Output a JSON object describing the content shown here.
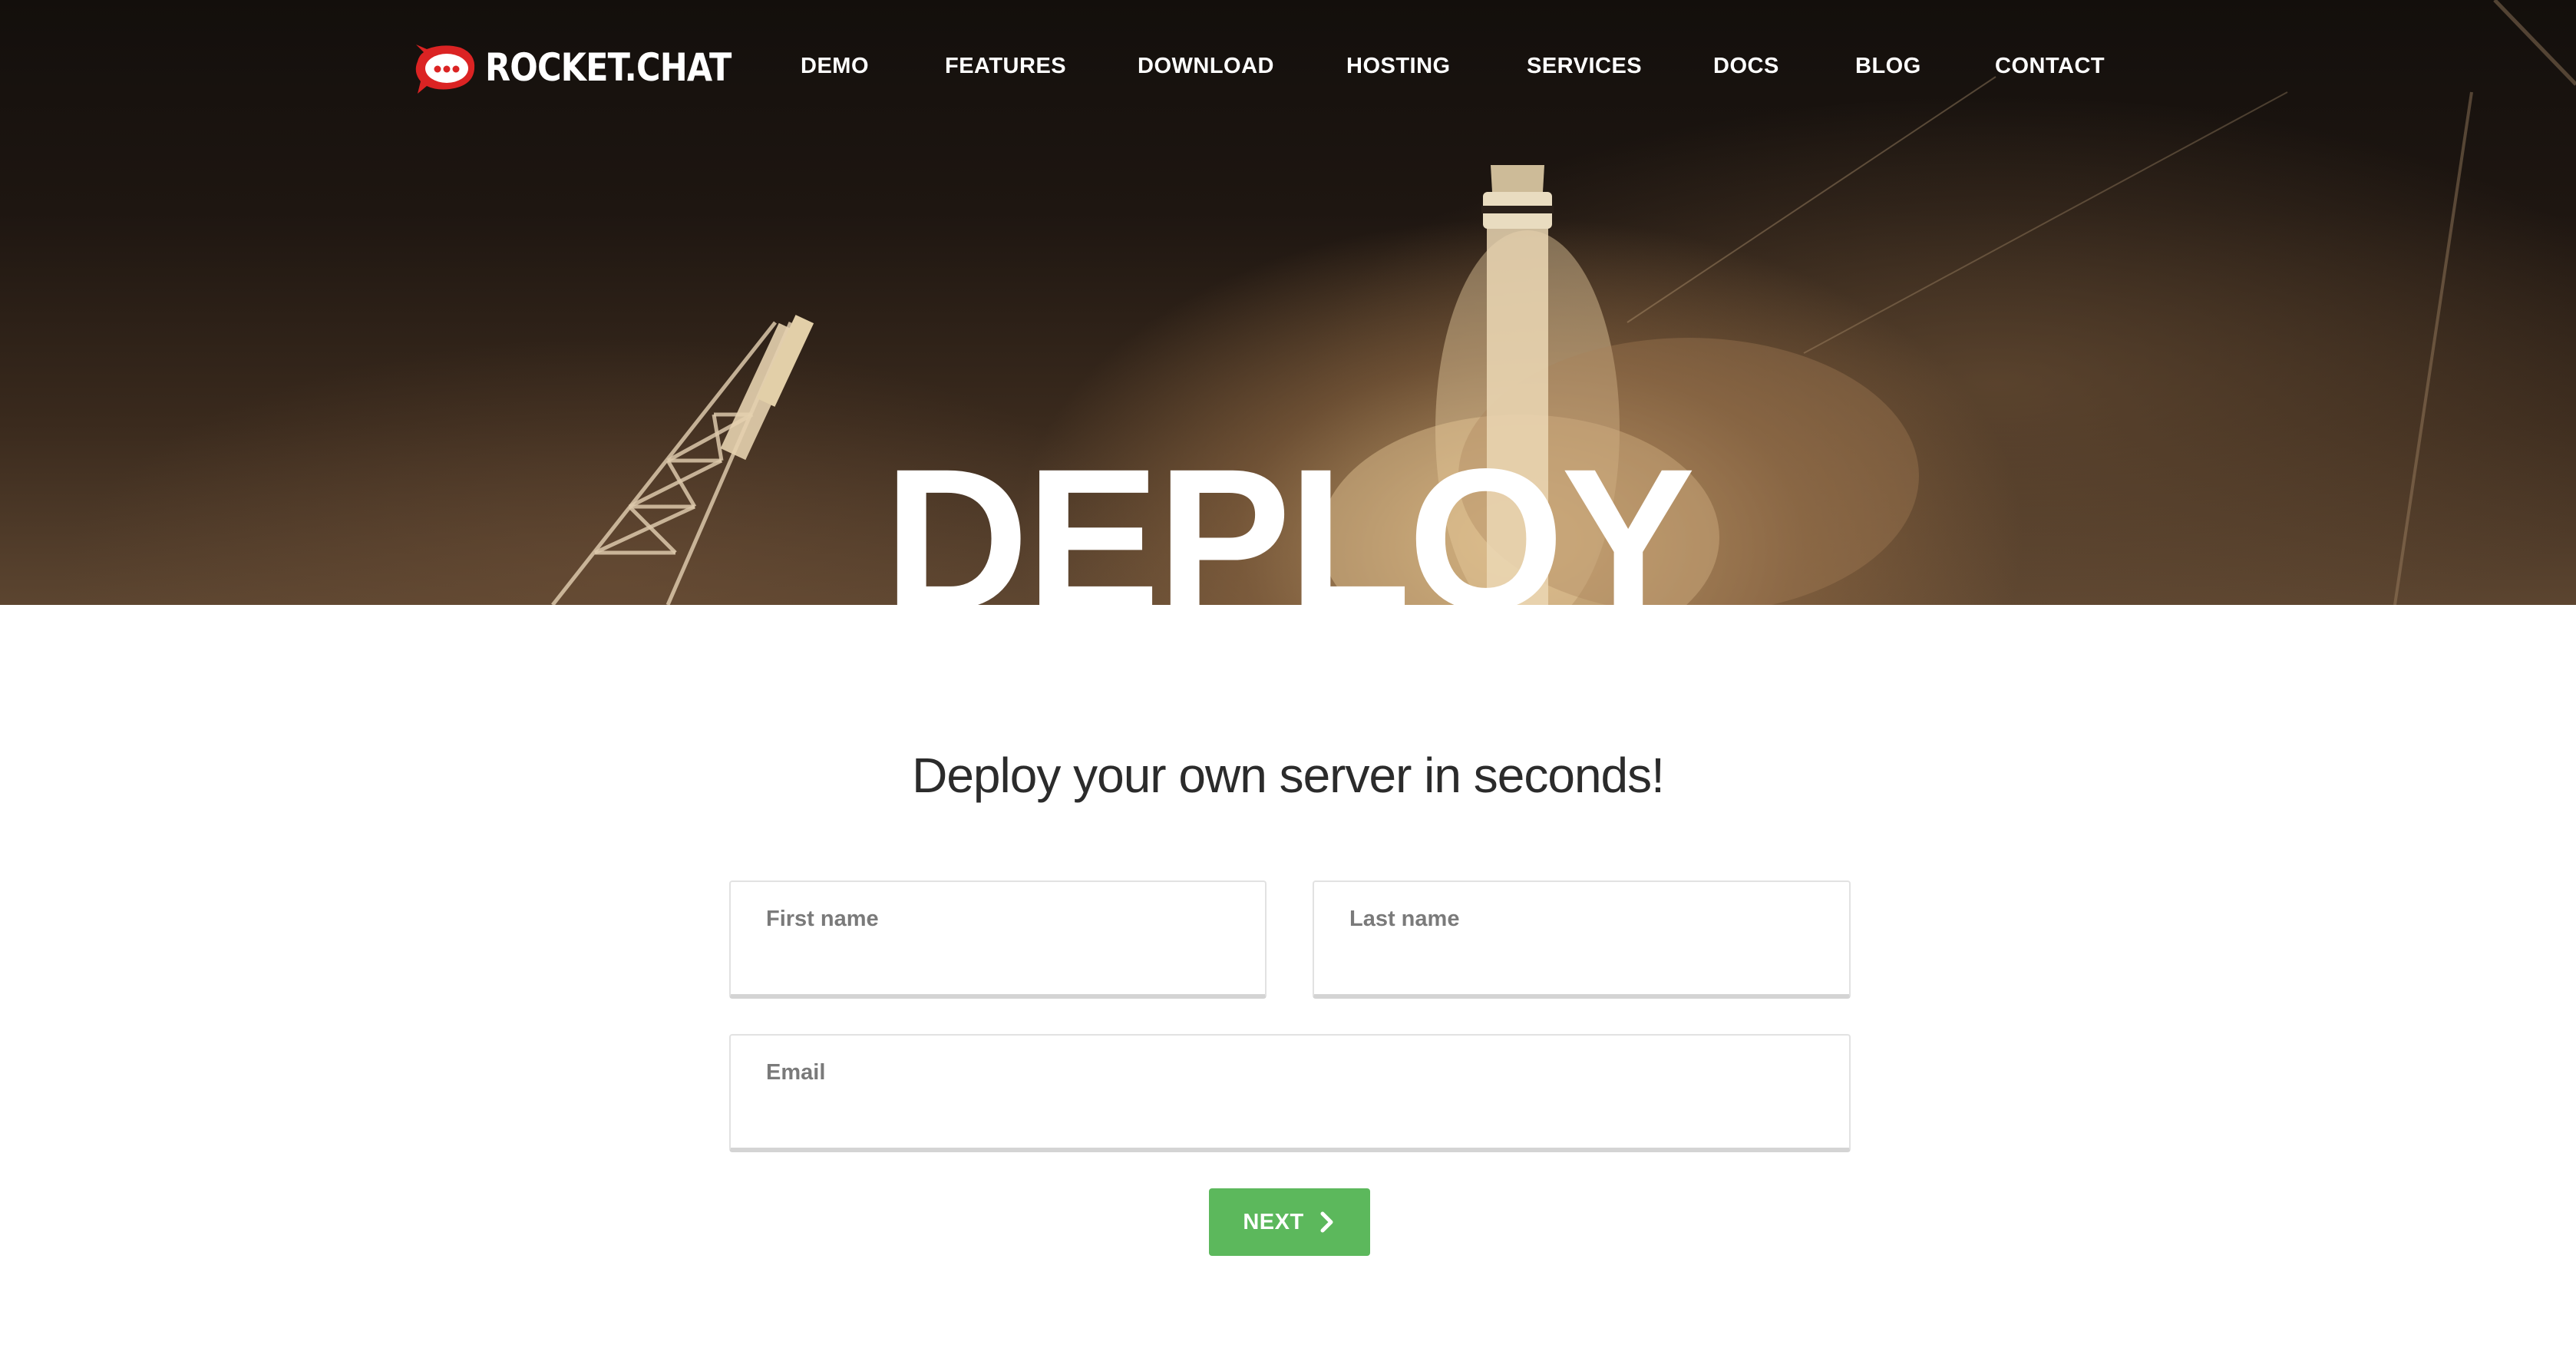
{
  "brand": {
    "name": "ROCKET.CHAT",
    "logo_icon": "rocket-chat-bubble-icon",
    "logo_color": "#db2323"
  },
  "nav": {
    "items": [
      {
        "label": "DEMO"
      },
      {
        "label": "FEATURES"
      },
      {
        "label": "DOWNLOAD"
      },
      {
        "label": "HOSTING"
      },
      {
        "label": "SERVICES"
      },
      {
        "label": "DOCS"
      },
      {
        "label": "BLOG"
      },
      {
        "label": "CONTACT"
      }
    ]
  },
  "hero": {
    "title": "DEPLOY"
  },
  "main": {
    "headline": "Deploy your own server in seconds!",
    "form": {
      "first_name": {
        "label": "First name",
        "value": ""
      },
      "last_name": {
        "label": "Last name",
        "value": ""
      },
      "email": {
        "label": "Email",
        "value": ""
      },
      "next_label": "NEXT",
      "next_icon": "chevron-right-icon"
    }
  },
  "colors": {
    "accent_green": "#5cb85c",
    "brand_red": "#db2323",
    "headline_text": "#2b2b2b",
    "field_label": "#7a7a7a"
  }
}
